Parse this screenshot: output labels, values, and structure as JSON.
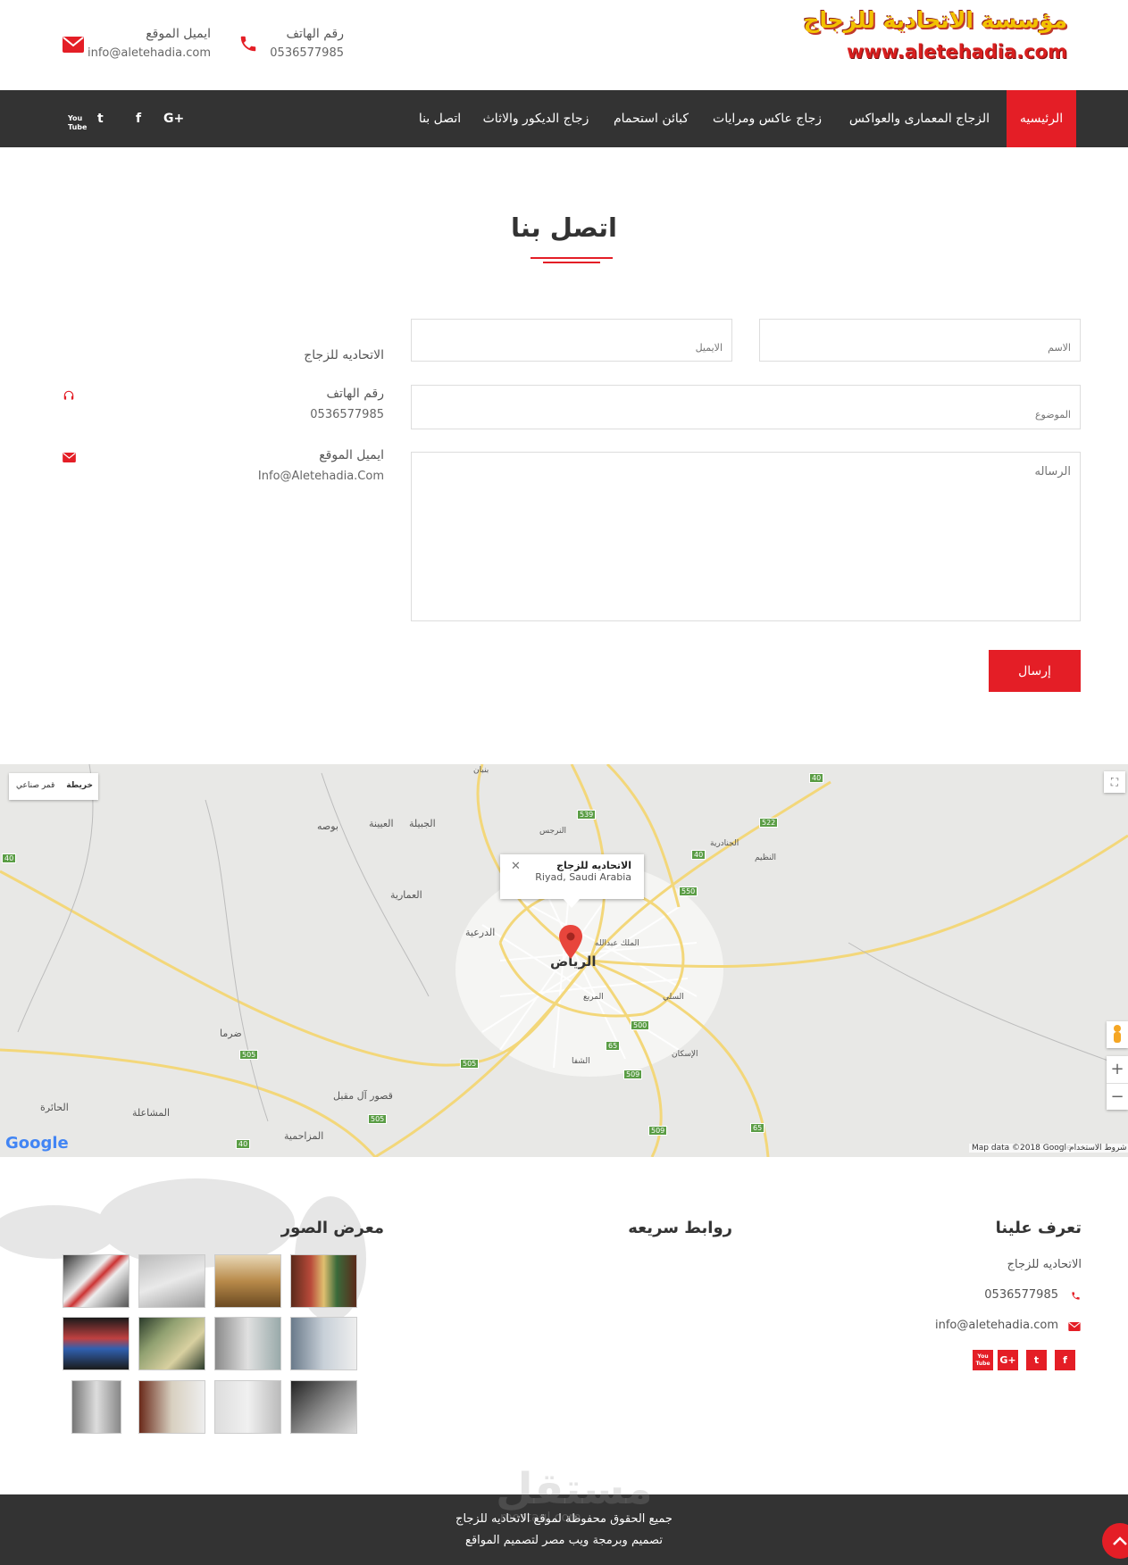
{
  "brand": {
    "name": "مؤسسة الاتحادية للزجاج",
    "url": "www.aletehadia.com"
  },
  "header": {
    "phone_title": "رقم الهاتف",
    "phone_value": "0536577985",
    "email_title": "ايميل الموقع",
    "email_value": "info@aletehadia.com"
  },
  "nav": {
    "items": [
      "الرئيسيه",
      "الزجاج المعمارى والعواكس",
      "زجاج عاكس ومرايات",
      "كبائن استحمام",
      "زجاج الديكور والاثاث",
      "اتصل بنا"
    ],
    "social": [
      "You Tube",
      "t",
      "f",
      "G+"
    ]
  },
  "page": {
    "title": "اتصل بنا"
  },
  "form": {
    "name_placeholder": "الاسم",
    "email_placeholder": "الايميل",
    "subject_placeholder": "الموضوع",
    "message_placeholder": "الرساله",
    "send_label": "إرسال"
  },
  "contact_info": {
    "company": "الاتحاديه للزجاج",
    "phone_title": "رقم الهاتف",
    "phone_value": "0536577985",
    "email_title": "ايميل الموقع",
    "email_value": "Info@Aletehadia.Com"
  },
  "map": {
    "type_map": "خريطة",
    "type_satellite": "قمر صناعي",
    "info_title": "الاتحاديه للزجاج",
    "info_address": "Riyad, Saudi Arabia",
    "city_label": "الرياض",
    "attribution": "Map data ©2018 Google",
    "terms": "شروط الاستخدام",
    "google": "Google",
    "places": [
      "بوصه",
      "العيينة",
      "الجبيلة",
      "العمارية",
      "الدرعية",
      "ضرما",
      "الحائرة",
      "المشاعلة",
      "المزاحمية",
      "قصور آل مقبل",
      "النرجس",
      "الملك عبدالله",
      "المربع",
      "الشفا",
      "السلي",
      "الجنادرية",
      "النظيم",
      "الإسكان",
      "بنبان"
    ],
    "shields": [
      "539",
      "522",
      "550",
      "40",
      "500",
      "65",
      "509",
      "505",
      "40",
      "505",
      "505",
      "509",
      "40",
      "65",
      "40"
    ]
  },
  "footer": {
    "about_title": "تعرف علينا",
    "links_title": "روابط سريعه",
    "gallery_title": "معرض الصور",
    "company": "الاتحاديه للزجاج",
    "phone": "0536577985",
    "email": "info@aletehadia.com",
    "social": [
      "You Tube",
      "G+",
      "t",
      "f"
    ],
    "rights": "جميع الحقوق محفوظة لموقع الاتحاديه للزجاج",
    "credit": "تصميم وبرمجة ويب مصر لتصميم المواقع",
    "watermark": "مستقل",
    "watermark_url": "mostaql.com"
  },
  "colors": {
    "accent": "#e41e26",
    "nav_bg": "#333333"
  }
}
